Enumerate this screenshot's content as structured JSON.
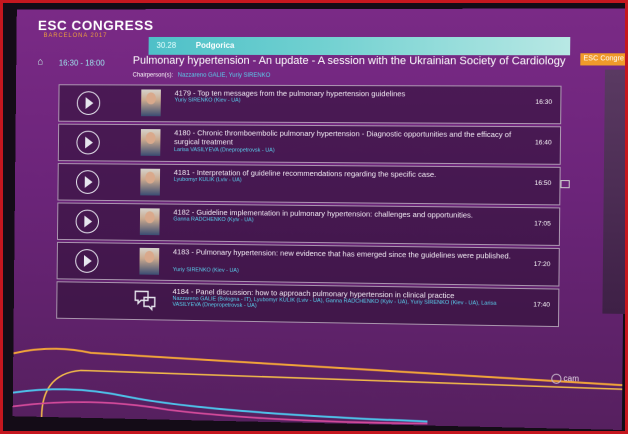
{
  "brand": {
    "title": "ESC CONGRESS",
    "subtitle": "BARCELONA 2017"
  },
  "tabbar": {
    "date": "30.28",
    "room": "Podgorica"
  },
  "corner_tag": "ESC Congre",
  "session": {
    "time_range": "16:30 - 18:00",
    "title": "Pulmonary hypertension - An update - A session with the Ukrainian Society of Cardiology",
    "chair_label": "Chairperson(s):",
    "chair_names": "Nazzareno GALIE, Yuriy SIRENKO"
  },
  "talks": [
    {
      "title": "4179 - Top ten messages from the pulmonary hypertension guidelines",
      "speaker": "Yuriy SIRENKO (Kiev - UA)",
      "time": "16:30",
      "kind": "video"
    },
    {
      "title": "4180 - Chronic thromboembolic pulmonary hypertension - Diagnostic opportunities and the efficacy of surgical treatment",
      "speaker": "Larisa VASILYEVA (Dnepropetrovsk - UA)",
      "time": "16:40",
      "kind": "video"
    },
    {
      "title": "4181 - Interpretation of guideline recommendations regarding the specific case.",
      "speaker": "Lyubomyr KULIK (Lviv - UA)",
      "time": "16:50",
      "kind": "video"
    },
    {
      "title": "4182 - Guideline implementation in pulmonary hypertension: challenges and opportunities.",
      "speaker": "Ganna RADCHENKO (Kyiv - UA)",
      "time": "17:05",
      "kind": "video"
    },
    {
      "title": "4183 - Pulmonary hypertension: new evidence that has emerged since the guidelines were published.",
      "speaker": "Yuriy SIRENKO (Kiev - UA)",
      "time": "17:20",
      "kind": "video"
    },
    {
      "title": "4184 - Panel discussion: how to approach pulmonary hypertension in clinical practice",
      "speaker": "Nazzareno GALIE (Bologna - IT), Lyubomyr KULIK (Lviv - UA), Ganna RADCHENKO (Kyiv - UA), Yuriy SIRENKO (Kiev - UA), Larisa VASILYEVA (Dnepropetrovsk - UA)",
      "time": "17:40",
      "kind": "discussion"
    }
  ],
  "footer": {
    "logo_text": "cam"
  },
  "icons": {
    "home": "home-icon",
    "play": "play-icon",
    "discussion": "speech-bubbles-icon"
  },
  "colors": {
    "accent_cyan": "#59d2f0",
    "brand_orange": "#f0a33a",
    "background_purple": "#6b2479"
  }
}
